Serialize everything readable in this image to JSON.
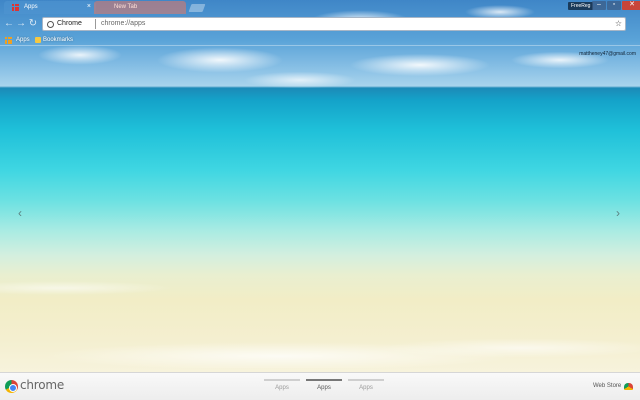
{
  "window": {
    "tabs": [
      {
        "label": "Apps",
        "active": true
      },
      {
        "label": "New Tab",
        "active": false
      }
    ],
    "profile_badge": "FreeReg",
    "controls": {
      "minimize": "–",
      "maximize": "▫",
      "close": "✕"
    }
  },
  "toolbar": {
    "back": "←",
    "forward": "→",
    "reload": "↻",
    "site_label": "Chrome",
    "url": "chrome://apps",
    "bookmark_star": "☆"
  },
  "bookmarks": [
    {
      "label": "Apps",
      "icon": "apps-grid-icon"
    },
    {
      "label": "Bookmarks",
      "icon": "folder-icon"
    }
  ],
  "user": {
    "email": "mattheney47@gmail.com"
  },
  "navigation": {
    "prev_arrow": "‹",
    "next_arrow": "›"
  },
  "bottom": {
    "brand": "chrome",
    "pages": [
      {
        "label": "Apps",
        "active": false
      },
      {
        "label": "Apps",
        "active": true
      },
      {
        "label": "Apps",
        "active": false
      }
    ],
    "web_store": "Web Store"
  },
  "colors": {
    "sky": "#5aa3d8",
    "sea": "#1fc0d9",
    "sand": "#f2edc6",
    "close_button": "#c9453a"
  }
}
